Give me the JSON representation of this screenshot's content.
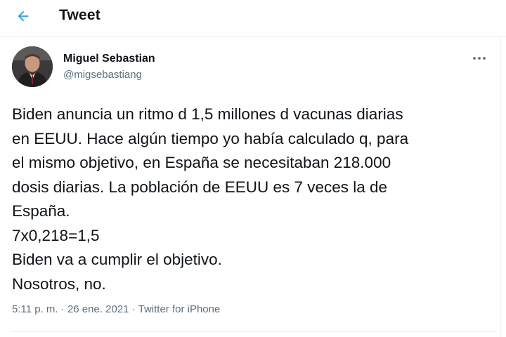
{
  "header": {
    "back_icon": "arrow-left-icon",
    "title": "Tweet"
  },
  "colors": {
    "accent": "#1da1f2",
    "text": "#0f1419",
    "secondary": "#5b7083",
    "divider": "#e6ecf0"
  },
  "tweet": {
    "author": {
      "name": "Miguel Sebastian",
      "handle": "@migsebastiang"
    },
    "more_icon": "more-horizontal-icon",
    "text": "Biden anuncia un ritmo d 1,5 millones d vacunas diarias\nen EEUU. Hace algún tiempo yo había calculado q, para\nel mismo objetivo, en España se necesitaban 218.000\ndosis diarias. La población de EEUU es 7 veces la de\nEspaña.\n7x0,218=1,5\nBiden va a cumplir el objetivo.\nNosotros, no.",
    "time": "5:11 p. m.",
    "date": "26 ene. 2021",
    "source": "Twitter for iPhone",
    "separator": "·"
  }
}
